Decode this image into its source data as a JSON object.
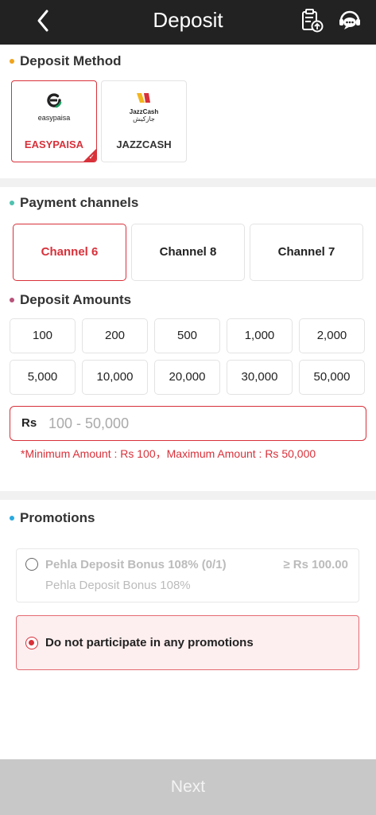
{
  "header": {
    "title": "Deposit"
  },
  "deposit_method": {
    "title": "Deposit Method",
    "dot_color": "#f0a31c",
    "methods": [
      {
        "logo_text": "easypaisa",
        "label": "EASYPAISA",
        "selected": true
      },
      {
        "logo_text": "JazzCash",
        "logo_text_urdu": "جازکیش",
        "label": "JAZZCASH",
        "selected": false
      }
    ]
  },
  "payment_channels": {
    "title": "Payment channels",
    "dot_color": "#4fc2b0",
    "channels": [
      {
        "label": "Channel 6",
        "selected": true
      },
      {
        "label": "Channel 8",
        "selected": false
      },
      {
        "label": "Channel 7",
        "selected": false
      }
    ]
  },
  "deposit_amounts": {
    "title": "Deposit Amounts",
    "dot_color": "#b8527a",
    "amounts": [
      "100",
      "200",
      "500",
      "1,000",
      "2,000",
      "5,000",
      "10,000",
      "20,000",
      "30,000",
      "50,000"
    ],
    "currency": "Rs",
    "placeholder": "100 - 50,000",
    "limits_note": "*Minimum Amount : Rs 100，Maximum Amount : Rs 50,000"
  },
  "promotions": {
    "title": "Promotions",
    "dot_color": "#29a9e0",
    "items": [
      {
        "name": "Pehla Deposit Bonus 108% (0/1)",
        "min": "≥ Rs 100.00",
        "subtitle": "Pehla Deposit Bonus 108%",
        "selected": false
      },
      {
        "name": "Do not participate in any promotions",
        "selected": true
      }
    ]
  },
  "footer": {
    "next_label": "Next"
  },
  "colors": {
    "accent": "#d8313a",
    "header_bg": "#222222",
    "disabled_button": "#c8c8c8"
  }
}
